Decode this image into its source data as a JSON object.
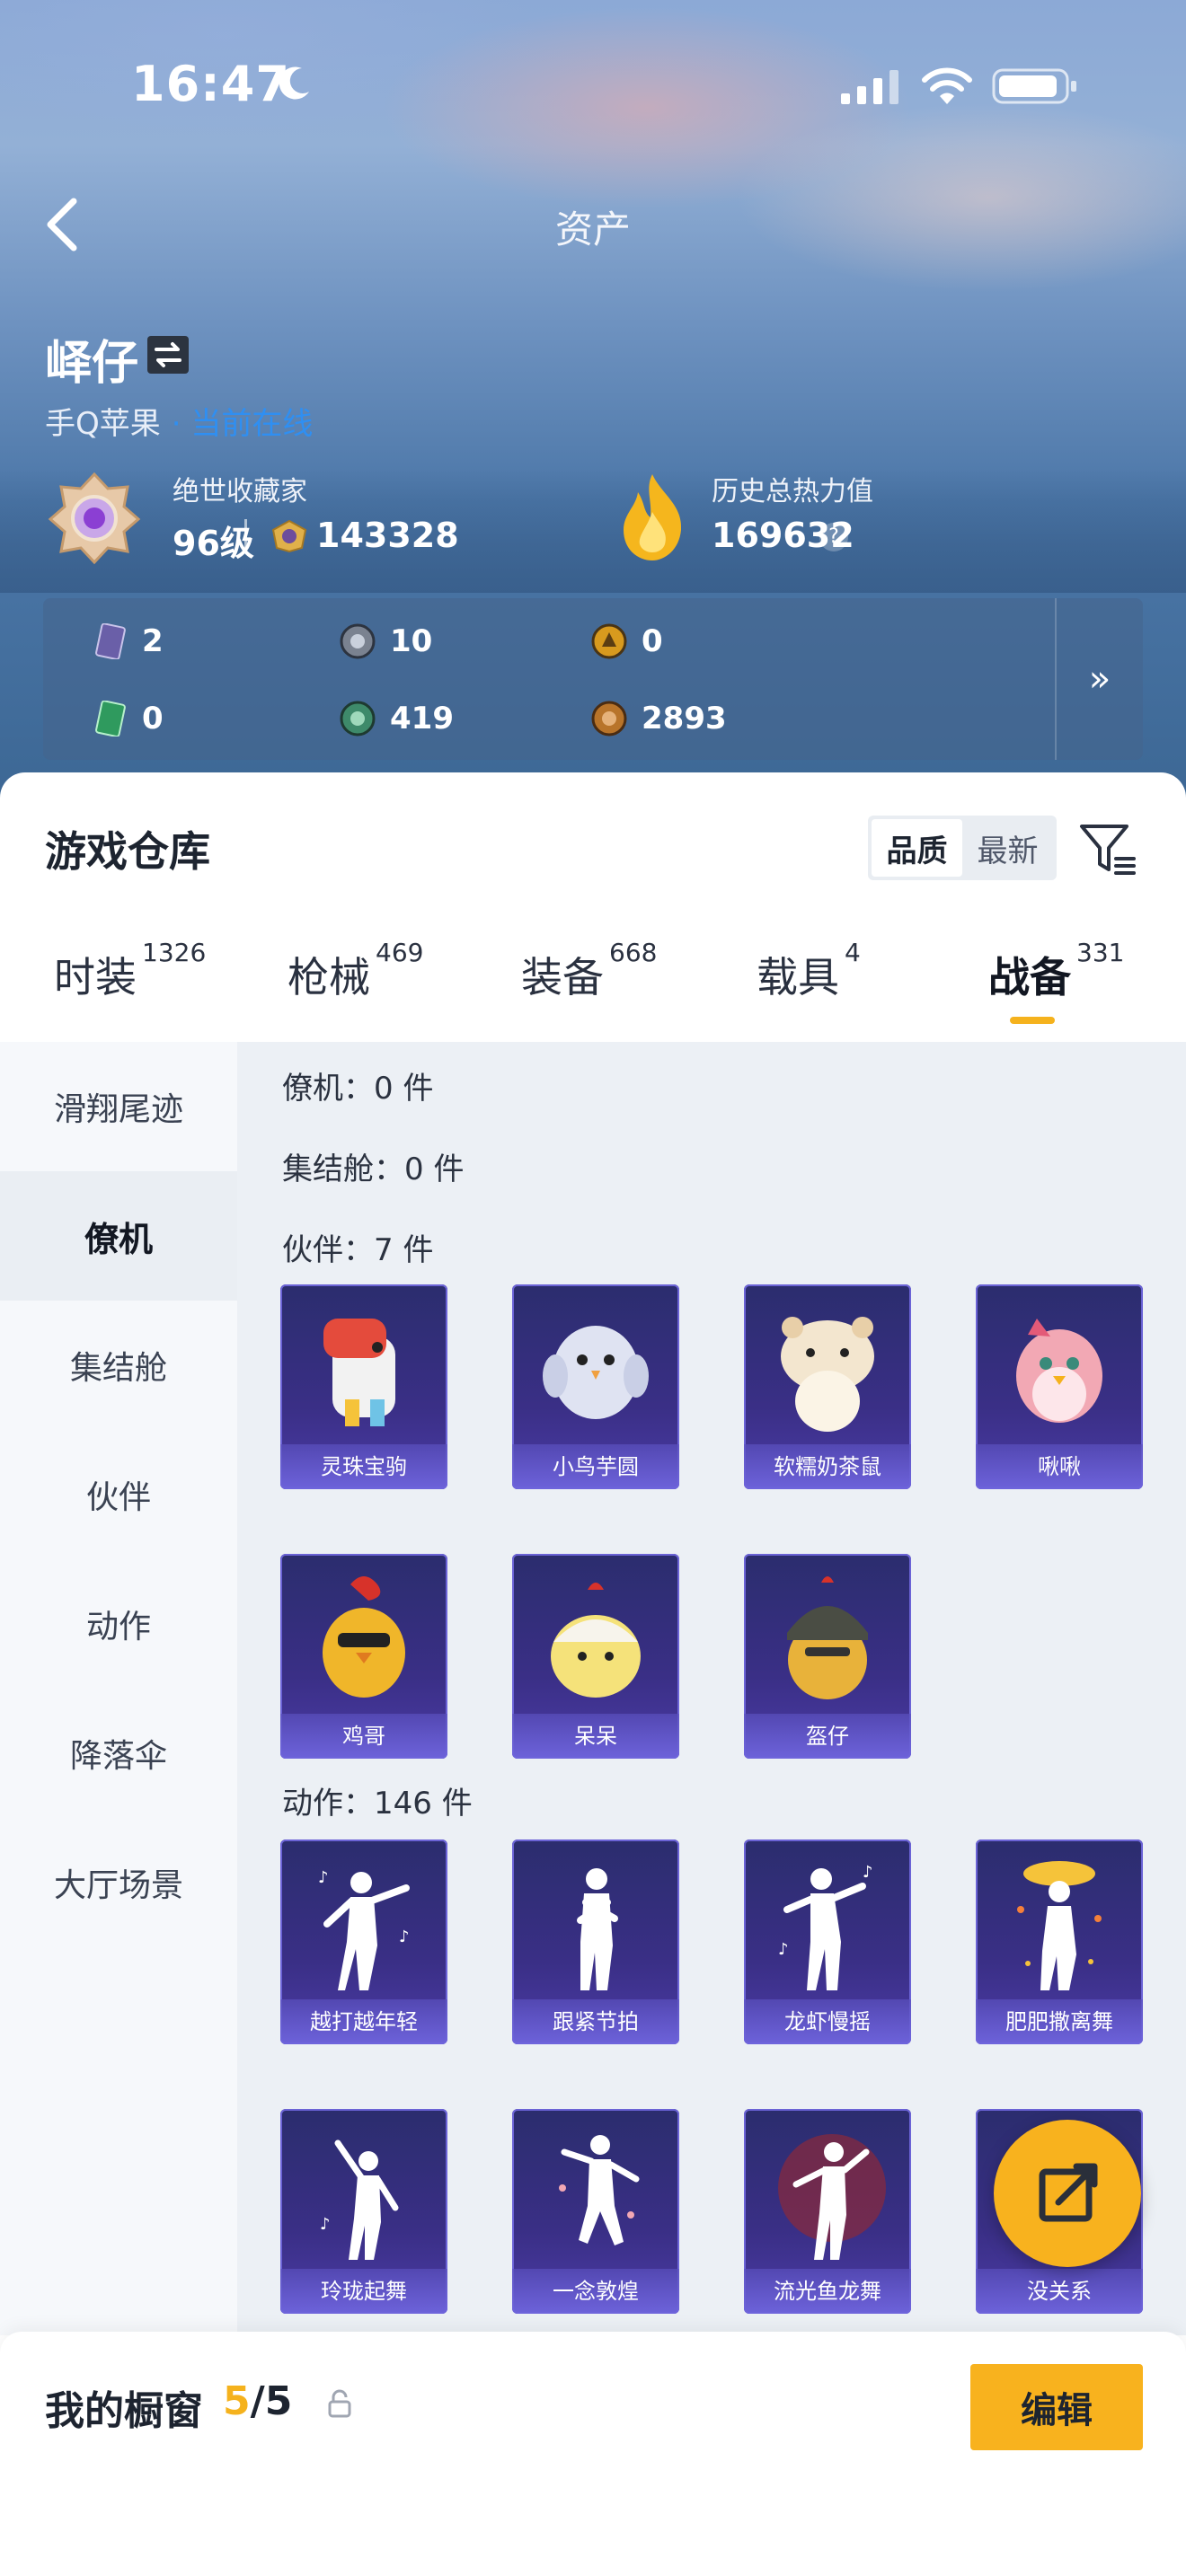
{
  "status_bar": {
    "time": "16:47"
  },
  "header": {
    "title": "资产"
  },
  "profile": {
    "name": "峄仔",
    "platform": "手Q苹果",
    "status": "· 当前在线",
    "rank_title": "绝世收藏家",
    "rank_level": "96级",
    "collect_points": "143328",
    "heat_title": "历史总热力值",
    "heat_value": "169632",
    "help": "?"
  },
  "currencies": [
    {
      "icon": "card-icon",
      "value": "2",
      "color": "#6a5fa8"
    },
    {
      "icon": "silver-coin-icon",
      "value": "10",
      "color": "#7a8290"
    },
    {
      "icon": "gold-coin-icon",
      "value": "0",
      "color": "#d89a1e"
    },
    {
      "icon": "green-card-icon",
      "value": "0",
      "color": "#2f9a5e"
    },
    {
      "icon": "green-coin-icon",
      "value": "419",
      "color": "#3e8a6a"
    },
    {
      "icon": "bronze-coin-icon",
      "value": "2893",
      "color": "#b8742a"
    }
  ],
  "currency_more": "»",
  "warehouse": {
    "title": "游戏仓库",
    "sort": [
      "品质",
      "最新"
    ],
    "tabs": [
      {
        "label": "时装",
        "count": "1326"
      },
      {
        "label": "枪械",
        "count": "469"
      },
      {
        "label": "装备",
        "count": "668"
      },
      {
        "label": "载具",
        "count": "4"
      },
      {
        "label": "战备",
        "count": "331"
      }
    ],
    "side_nav": [
      "滑翔尾迹",
      "僚机",
      "集结舱",
      "伙伴",
      "动作",
      "降落伞",
      "大厅场景"
    ],
    "sections": {
      "wingman": "僚机：0 件",
      "assembly": "集结舱：0 件",
      "partner": "伙伴：7 件",
      "emote": "动作：146 件"
    },
    "partners": [
      "灵珠宝驹",
      "小鸟芋圆",
      "软糯奶茶鼠",
      "啾啾",
      "鸡哥",
      "呆呆",
      "盔仔"
    ],
    "emotes": [
      "越打越年轻",
      "跟紧节拍",
      "龙虾慢摇",
      "肥肥撒离舞",
      "玲珑起舞",
      "一念敦煌",
      "流光鱼龙舞",
      "没关系"
    ]
  },
  "showcase": {
    "title": "我的橱窗",
    "used": "5",
    "total": "/5",
    "edit": "编辑"
  },
  "colors": {
    "accent": "#f5b21d",
    "online": "#2f8ff2",
    "card": "#3a2f86"
  }
}
